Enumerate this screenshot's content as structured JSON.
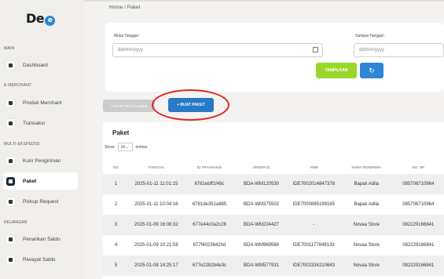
{
  "brand": {
    "logo_text": "De",
    "logo_mark": "e"
  },
  "sidebar": {
    "sections": [
      {
        "title": "MAIN",
        "items": [
          {
            "label": "Dashboard",
            "icon": "home-icon"
          }
        ]
      },
      {
        "title": "E-MERCHANT",
        "items": [
          {
            "label": "Produk Merchant",
            "icon": "box-icon"
          },
          {
            "label": "Transaksi",
            "icon": "cart-icon"
          }
        ]
      },
      {
        "title": "MULTI-EKSPEDISI",
        "items": [
          {
            "label": "Kurir Pengiriman",
            "icon": "truck-icon"
          },
          {
            "label": "Paket",
            "icon": "package-icon",
            "active": true
          },
          {
            "label": "Pickup Request",
            "icon": "pickup-icon"
          }
        ]
      },
      {
        "title": "KEUANGAN",
        "items": [
          {
            "label": "Penarikan Saldo",
            "icon": "wallet-icon"
          },
          {
            "label": "Riwayat Saldo",
            "icon": "history-icon"
          }
        ]
      }
    ]
  },
  "breadcrumb": {
    "home": "Home",
    "sep": "/",
    "current": "Paket"
  },
  "filter": {
    "start_label": "Mulai Tanggal :",
    "start_placeholder": "dd/mm/yyyy",
    "end_label": "Sampai Tanggal :",
    "end_placeholder": "dd/mm/yyyy",
    "submit_label": "TAMPILKAN",
    "refresh_icon": "refresh-icon"
  },
  "actions": {
    "multi_label": "+ PAKET MULTI KURIR",
    "create_label": "+ BUAT PAKET"
  },
  "table": {
    "title": "Paket",
    "show_label": "Show",
    "show_value": "10",
    "entries_label": "entries",
    "columns": [
      "NO",
      "TANGGAL",
      "ID TRANSAKSI",
      "ORDER ID",
      "AWB",
      "NAMA PENERIMA",
      "NO. HP"
    ],
    "rows": [
      [
        "1",
        "2025-01-11 11:01:15",
        "6781ebff1f49c",
        "BDA-WM120530",
        "IDE7002014847378",
        "Bapak Adila",
        "085706710964"
      ],
      [
        "2",
        "2025-01-11 10:04:16",
        "6781de351a885",
        "BDA-WM375502",
        "IDE7000885199165",
        "Bapak Adila",
        "085706710964"
      ],
      [
        "3",
        "2025-01-09 16:08:32",
        "677e44c0a2c28",
        "BDA-WM224427",
        "-",
        "Novaa Store",
        "082229166841"
      ],
      [
        "4",
        "2025-01-09 10:21:59",
        "677f40236420d",
        "BDA-WM969568",
        "IDE7001177849133",
        "Novaa Store",
        "082229166841"
      ],
      [
        "5",
        "2025-01-08 14:25:17",
        "677e2282b4e3c",
        "BDA-WM577931",
        "IDE7002334210643",
        "Novaa Store",
        "082229166841"
      ]
    ]
  }
}
